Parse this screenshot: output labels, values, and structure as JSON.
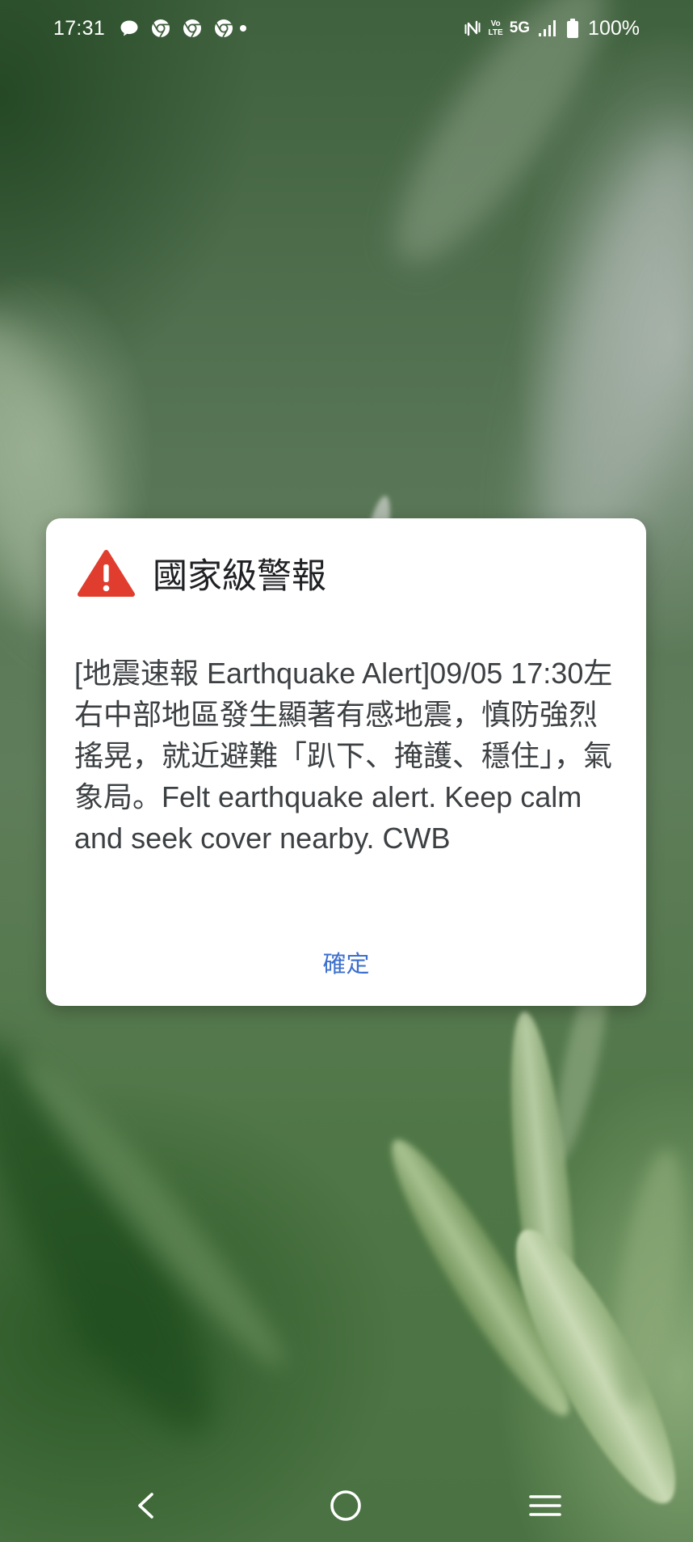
{
  "status_bar": {
    "time": "17:31",
    "notification_icons": [
      "line-icon",
      "chrome-icon",
      "chrome-icon",
      "chrome-icon",
      "notification-dot-icon"
    ],
    "system_icons": [
      "nfc-icon",
      "volte-icon",
      "signal-icon",
      "battery-icon"
    ],
    "volte_top": "Vo",
    "volte_bottom": "LTE",
    "network_type": "5G",
    "signal_bars_filled": 4,
    "battery_level": "100%"
  },
  "alert_dialog": {
    "icon": "warning-icon",
    "title": "國家級警報",
    "message": "[地震速報 Earthquake Alert]09/05 17:30左右中部地區發生顯著有感地震，慎防強烈搖晃，就近避難「趴下、掩護、穩住」，氣象局。Felt earthquake alert. Keep calm and seek cover nearby. CWB",
    "confirm_label": "確定"
  },
  "nav_bar": {
    "buttons": [
      "back-icon",
      "home-icon",
      "recents-menu-icon"
    ]
  },
  "colors": {
    "accent": "#3b6fce",
    "warning": "#e03d2f",
    "dialog_bg": "#ffffff",
    "title_text": "#202124",
    "body_text": "#3c4043",
    "status_text": "#ffffff"
  }
}
